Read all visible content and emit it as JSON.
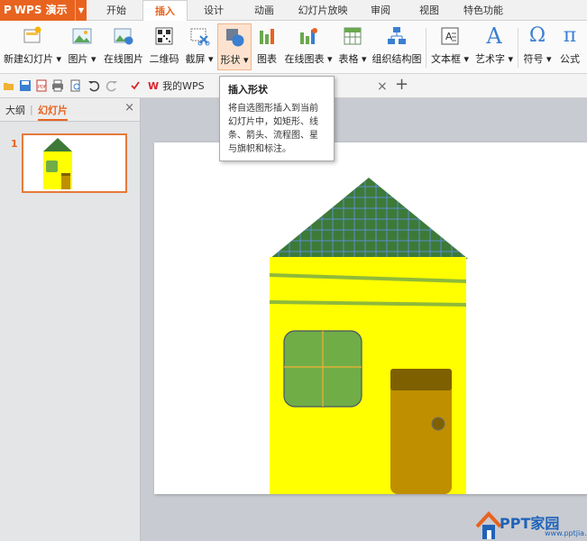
{
  "app": {
    "name": "WPS 演示",
    "logo_letter": "P"
  },
  "menu": {
    "tabs": [
      "开始",
      "插入",
      "设计",
      "动画",
      "幻灯片放映",
      "审阅",
      "视图",
      "特色功能"
    ],
    "active": "插入"
  },
  "ribbon": {
    "new_slide": "新建幻灯片",
    "picture": "图片",
    "online_picture": "在线图片",
    "qrcode": "二维码",
    "screenshot": "截屏",
    "shape": "形状",
    "chart": "图表",
    "online_chart": "在线图表",
    "table": "表格",
    "smartart": "组织结构图",
    "textbox": "文本框",
    "wordart": "艺术字",
    "symbol": "符号",
    "formula": "公式",
    "wordart_glyph": "A",
    "symbol_glyph": "Ω",
    "formula_glyph": "π"
  },
  "tabbar": {
    "doc_tab": "我的WPS",
    "doc_tab_icon_letter": "W",
    "close_glyph": "×",
    "new_tab_glyph": "+"
  },
  "tooltip": {
    "title": "插入形状",
    "body": "将自选图形插入到当前幻灯片中，如矩形、线条、箭头、流程图、星与旗帜和标注。"
  },
  "left_panel": {
    "tab_outline": "大纲",
    "tab_slides": "幻灯片",
    "close_glyph": "×",
    "slide_number": "1"
  },
  "watermark": {
    "text": "PPT家园",
    "subtext": "www.pptjia.com"
  },
  "colors": {
    "accent": "#e8631f",
    "house_wall": "#ffff00",
    "roof": "#3d7a38",
    "roof_grid": "#5b8fd1",
    "window": "#70ad47",
    "door": "#bf8f00",
    "door_top": "#7f6000"
  }
}
